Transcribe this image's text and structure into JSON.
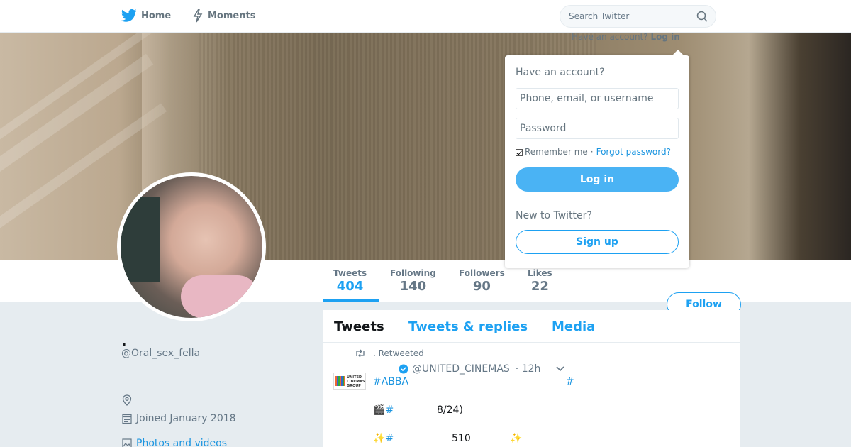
{
  "nav": {
    "home": "Home",
    "moments": "Moments",
    "search_placeholder": "Search Twitter",
    "have_account": "Have an account?",
    "login_link": "Log in"
  },
  "login_dropdown": {
    "title": "Have an account?",
    "username_placeholder": "Phone, email, or username",
    "password_placeholder": "Password",
    "remember": "Remember me",
    "separator": "·",
    "forgot": "Forgot password?",
    "login_button": "Log in",
    "new_to": "New to Twitter?",
    "signup_button": "Sign up"
  },
  "stats": [
    {
      "label": "Tweets",
      "value": "404"
    },
    {
      "label": "Following",
      "value": "140"
    },
    {
      "label": "Followers",
      "value": "90"
    },
    {
      "label": "Likes",
      "value": "22"
    }
  ],
  "follow_button": "Follow",
  "profile": {
    "name": ".",
    "handle": "@Oral_sex_fella",
    "joined": "Joined January 2018",
    "photos_link": "Photos and videos"
  },
  "tabs": [
    "Tweets",
    "Tweets & replies",
    "Media"
  ],
  "tweet": {
    "retweeted": ". Retweeted",
    "author_handle": "@UNITED_CINEMAS",
    "time": "· 12h",
    "avatar_text": "UNITED CINEMAS GROUP",
    "line1_tag": "#ABBA",
    "line1_tag2": "#",
    "line2_emoji": "🎬",
    "line2_tag": "#",
    "line2_text": "8/24)",
    "line3_emoji": "✨",
    "line3_tag": "#",
    "line3_num": "510",
    "line3_emoji2": "✨"
  },
  "colors": {
    "accent": "#1da1f2",
    "link": "#1b95e0",
    "muted": "#657786"
  }
}
